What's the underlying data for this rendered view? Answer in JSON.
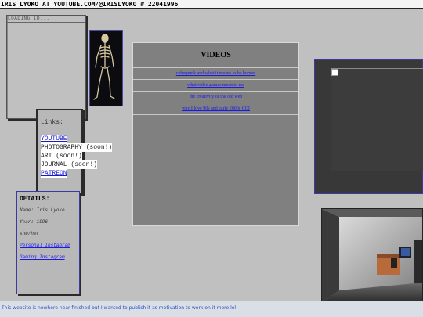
{
  "header": {
    "title": "IRIS LYOKO AT YOUTUBE.COM/@IRISLYOKO # 22041996"
  },
  "loading": {
    "text": "LOADING ID..."
  },
  "links": {
    "title": "Links:",
    "items": [
      {
        "label": "YOUTUBE",
        "active": true
      },
      {
        "label": "PHOTOGRAPHY (soon!)",
        "active": false
      },
      {
        "label": "ART (soon!)",
        "active": false
      },
      {
        "label": "JOURNAL (soon!)",
        "active": false
      },
      {
        "label": "PATREON",
        "active": true
      }
    ]
  },
  "videos": {
    "title": "VIDEOS",
    "items": [
      "cyberpunk and what it means to be human",
      "what video games mean to me",
      "the creativity of the old web",
      "why I love 90s and early 2000s CGI"
    ]
  },
  "details": {
    "title": "DETAILS:",
    "name": "Name: Iris Lyoko",
    "year": "Year: 1996",
    "pronouns": "she/her",
    "personal_instagram": "Personal Instagram",
    "gaming_instagram": "Gaming Instagram"
  },
  "footer": {
    "text": "This website is nowhere near finished but I wanted to publish it as motivation to work on it more lol"
  },
  "colors": {
    "background": "#c0c0c0",
    "link": "#1a1aee",
    "footer_text": "#2a4fbd"
  }
}
